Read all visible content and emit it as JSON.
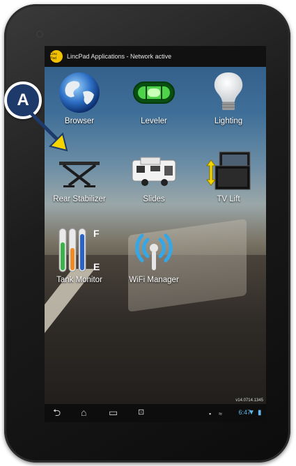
{
  "status_bar": {
    "title": "LincPad Applications - Network active",
    "logo_text": "Linc Pad",
    "time": "6:47"
  },
  "apps": [
    {
      "label": "Browser",
      "icon": "globe-icon"
    },
    {
      "label": "Leveler",
      "icon": "level-icon"
    },
    {
      "label": "Lighting",
      "icon": "lightbulb-icon"
    },
    {
      "label": "Rear Stabilizer",
      "icon": "stabilizer-icon"
    },
    {
      "label": "Slides",
      "icon": "rv-slides-icon"
    },
    {
      "label": "TV Lift",
      "icon": "tv-lift-icon"
    },
    {
      "label": "Tank Monitor",
      "icon": "tank-gauge-icon",
      "gauge_top": "F",
      "gauge_bottom": "E"
    },
    {
      "label": "WiFi Manager",
      "icon": "wifi-icon"
    }
  ],
  "version": "v14.0714.1345",
  "nav_bar": {
    "back": "back-icon",
    "home": "home-icon",
    "recents": "recents-icon",
    "screenshot": "screenshot-icon"
  },
  "callout": {
    "label": "A"
  },
  "colors": {
    "callout_fill": "#1d3a6b",
    "arrow": "#f5d400",
    "time_text": "#5fb7e9"
  }
}
